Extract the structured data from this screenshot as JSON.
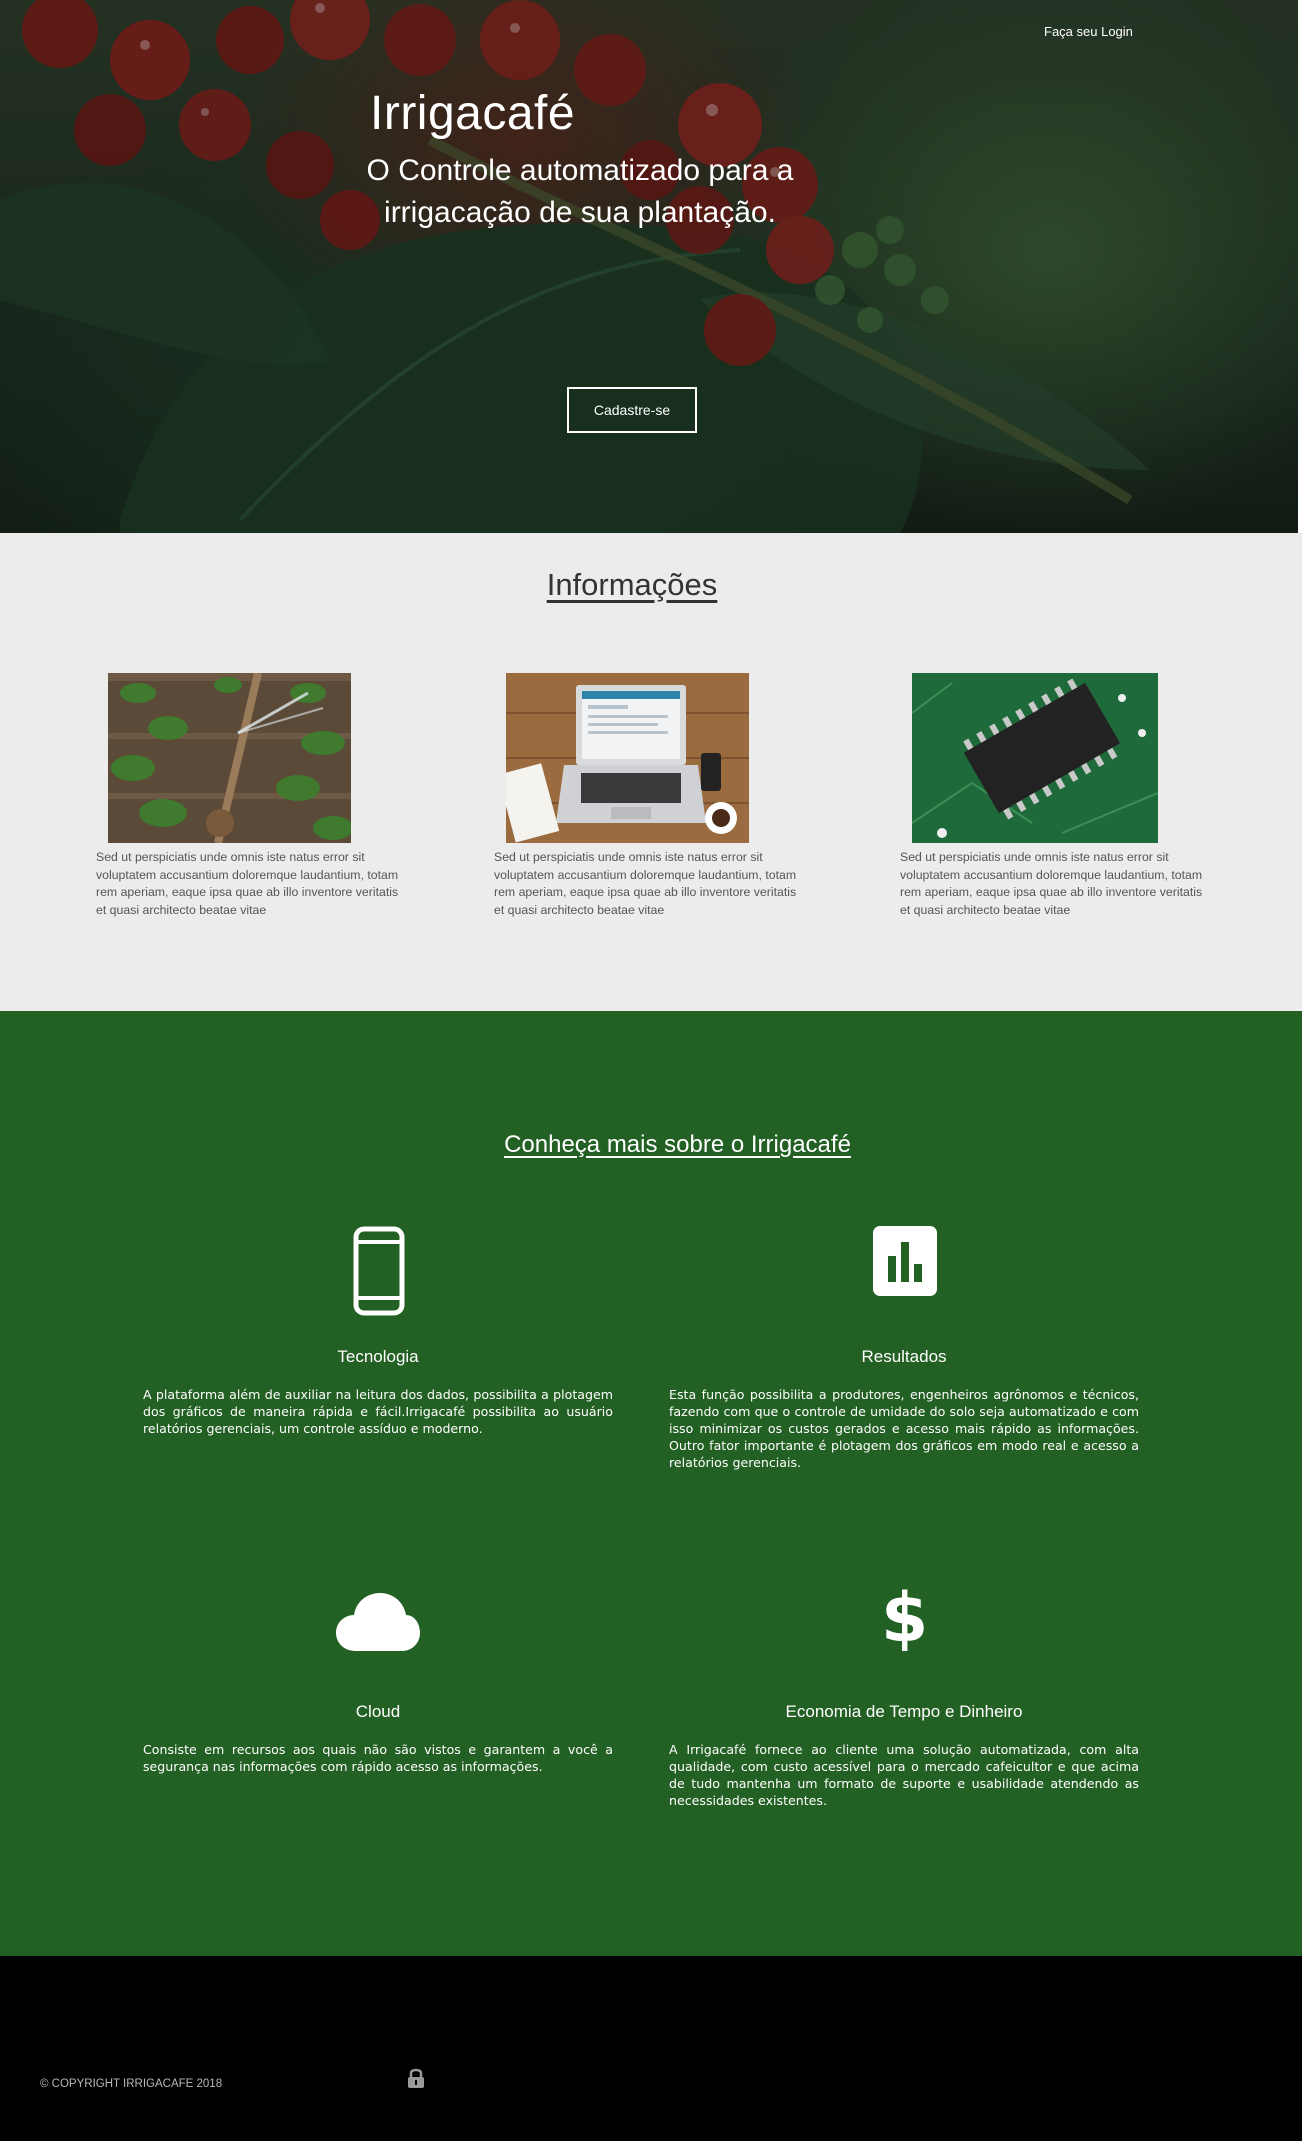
{
  "hero": {
    "login_link": "Faça seu Login",
    "brand": "Irrigacafé",
    "tagline": "O Controle automatizado para a irrigacação de sua plantação.",
    "signup_button": "Cadastre-se"
  },
  "info": {
    "title": "Informações",
    "cards": [
      {
        "image": "irrigation-sprinkler-photo",
        "text": "Sed ut perspiciatis unde omnis iste natus error sit voluptatem accusantium doloremque laudantium, totam rem aperiam, eaque ipsa quae ab illo inventore veritatis et quasi architecto beatae vitae"
      },
      {
        "image": "laptop-desk-photo",
        "text": "Sed ut perspiciatis unde omnis iste natus error sit voluptatem accusantium doloremque laudantium, totam rem aperiam, eaque ipsa quae ab illo inventore veritatis et quasi architecto beatae vitae"
      },
      {
        "image": "circuit-chip-photo",
        "text": "Sed ut perspiciatis unde omnis iste natus error sit voluptatem accusantium doloremque laudantium, totam rem aperiam, eaque ipsa quae ab illo inventore veritatis et quasi architecto beatae vitae"
      }
    ]
  },
  "features": {
    "title": "Conheça mais sobre o Irrigacafé",
    "items": [
      {
        "icon": "smartphone-icon",
        "title": "Tecnologia",
        "text": "A plataforma além de auxiliar na leitura dos dados, possibilita a plotagem dos gráficos de maneira rápida e fácil.Irrigacafé possibilita ao usuário relatórios gerenciais, um controle assíduo e moderno."
      },
      {
        "icon": "bar-chart-icon",
        "title": "Resultados",
        "text": "Esta função possibilita a produtores, engenheiros agrônomos e técnicos, fazendo com que o controle de umidade do solo seja automatizado e com isso minimizar os custos gerados e acesso mais rápido as informações. Outro fator importante é plotagem dos gráficos em modo real e acesso a relatórios gerenciais."
      },
      {
        "icon": "cloud-icon",
        "title": "Cloud",
        "text": "Consiste em recursos aos quais não são vistos e garantem a você a segurança nas informações com rápido acesso as informações."
      },
      {
        "icon": "dollar-icon",
        "title": "Economia de Tempo e Dinheiro",
        "text": "A Irrigacafé fornece ao cliente uma solução automatizada, com alta qualidade, com custo acessível para o mercado cafeicultor e que acima de tudo mantenha um formato de suporte e usabilidade atendendo as necessidades existentes."
      }
    ]
  },
  "footer": {
    "copyright": "© COPYRIGHT IRRIGACAFE  2018",
    "lock_icon": "lock-icon"
  },
  "colors": {
    "features_bg": "#236024",
    "info_bg": "#ececec",
    "footer_bg": "#000000"
  }
}
